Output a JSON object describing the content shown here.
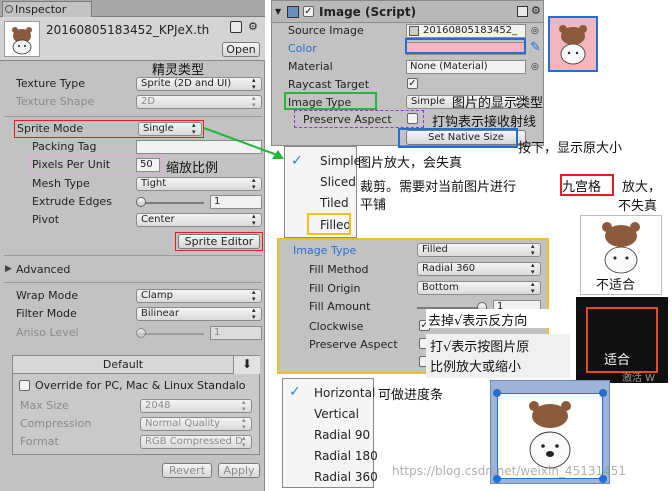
{
  "inspector": {
    "tab_title": "Inspector",
    "asset_name": "20160805183452_KPJeX.th",
    "open_label": "Open",
    "rows": {
      "texture_type": {
        "label": "Texture Type",
        "value": "Sprite (2D and UI)"
      },
      "texture_shape": {
        "label": "Texture Shape",
        "value": "2D"
      },
      "sprite_mode": {
        "label": "Sprite Mode",
        "value": "Single"
      },
      "packing_tag": {
        "label": "Packing Tag",
        "value": ""
      },
      "pixels_per_unit": {
        "label": "Pixels Per Unit",
        "value": "50"
      },
      "mesh_type": {
        "label": "Mesh Type",
        "value": "Tight"
      },
      "extrude_edges": {
        "label": "Extrude Edges",
        "value": "1"
      },
      "pivot": {
        "label": "Pivot",
        "value": "Center"
      }
    },
    "sprite_editor_label": "Sprite Editor",
    "advanced_label": "Advanced",
    "wrap_mode": {
      "label": "Wrap Mode",
      "value": "Clamp"
    },
    "filter_mode": {
      "label": "Filter Mode",
      "value": "Bilinear"
    },
    "aniso_level": {
      "label": "Aniso Level",
      "value": "1"
    },
    "platform_tab": "Default",
    "download_icon": "download-icon",
    "override_label": "Override for PC, Mac & Linux Standalo",
    "max_size": {
      "label": "Max Size",
      "value": "2048"
    },
    "compression": {
      "label": "Compression",
      "value": "Normal Quality"
    },
    "format": {
      "label": "Format",
      "value": "RGB Compressed D"
    },
    "revert_label": "Revert",
    "apply_label": "Apply"
  },
  "image_script": {
    "title": "Image (Script)",
    "source_image": {
      "label": "Source Image",
      "value": "20160805183452_"
    },
    "color": {
      "label": "Color",
      "swatch": "#f4b6bd"
    },
    "material": {
      "label": "Material",
      "value": "None (Material)"
    },
    "raycast_target": {
      "label": "Raycast Target"
    },
    "image_type": {
      "label": "Image Type",
      "value": "Simple"
    },
    "preserve_aspect": {
      "label": "Preserve Aspect"
    },
    "set_native_size": "Set Native Size"
  },
  "type_popup": {
    "options": [
      "Simple",
      "Sliced",
      "Tiled",
      "Filled"
    ],
    "selected": "Simple"
  },
  "filled_panel": {
    "image_type": {
      "label": "Image Type",
      "value": "Filled"
    },
    "fill_method": {
      "label": "Fill Method",
      "value": "Radial 360"
    },
    "fill_origin": {
      "label": "Fill Origin",
      "value": "Bottom"
    },
    "fill_amount": {
      "label": "Fill Amount",
      "value": "1",
      "level": 1.0
    },
    "clockwise": {
      "label": "Clockwise"
    },
    "preserve_aspect": {
      "label": "Preserve Aspect"
    }
  },
  "fill_popup": {
    "options": [
      "Horizontal",
      "Vertical",
      "Radial 90",
      "Radial 180",
      "Radial 360"
    ],
    "selected": "Horizontal"
  },
  "annotations": {
    "sprite_type": "精灵类型",
    "scale_ratio": "缩放比例",
    "display_type": "图片的显示类型",
    "preserve_hint": "打钩表示接收射线",
    "native_size_hint": "按下，显示原大小",
    "simple_hint": "图片放大，会失真",
    "sliced_hint_a": "裁剪。需要对当前图片进行",
    "sliced_hint_b": "九宫格",
    "sliced_hint_c": "放大，",
    "sliced_hint_d": "不失真",
    "tiled_hint": "平铺",
    "unsuitable": "不适合",
    "suitable": "适合",
    "clockwise_hint": "去掉√表示反方向",
    "preserve_hint2_a": "打√表示按图片原",
    "preserve_hint2_b": "比例放大或缩小",
    "progress_hint": "可做进度条",
    "watermark": "https://blog.csdn.net/weixin_45131451",
    "watermark2": "激活 W"
  },
  "colors": {
    "red": "#e02020",
    "green": "#1fb83a",
    "blue": "#1f6fd6",
    "pink": "#e67ed9",
    "orange": "#f0a500",
    "purple": "#9b30c8",
    "yellow": "#f0c020"
  }
}
